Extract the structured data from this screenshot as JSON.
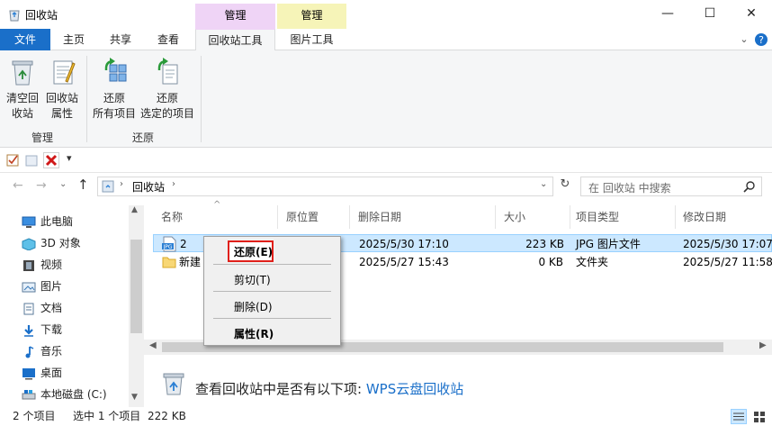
{
  "window": {
    "title": "回收站",
    "context_header_1": "管理",
    "context_header_2": "管理",
    "minimize_glyph": "—",
    "maximize_glyph": "☐",
    "close_glyph": "✕"
  },
  "tabs": {
    "file": "文件",
    "home": "主页",
    "share": "共享",
    "view": "查看",
    "recycle_tools": "回收站工具",
    "picture_tools": "图片工具"
  },
  "ribbon": {
    "empty_line1": "清空回",
    "empty_line2": "收站",
    "props_line1": "回收站",
    "props_line2": "属性",
    "restore_all_line1": "还原",
    "restore_all_line2": "所有项目",
    "restore_sel_line1": "还原",
    "restore_sel_line2": "选定的项目",
    "group_manage": "管理",
    "group_restore": "还原"
  },
  "address": {
    "path": "回收站",
    "search_placeholder": "在 回收站 中搜索"
  },
  "nav": {
    "items": [
      "此电脑",
      "3D 对象",
      "视频",
      "图片",
      "文档",
      "下载",
      "音乐",
      "桌面",
      "本地磁盘 (C:)"
    ]
  },
  "columns": {
    "name": "名称",
    "orig": "原位置",
    "deleted": "删除日期",
    "size": "大小",
    "type": "项目类型",
    "modified": "修改日期"
  },
  "files": [
    {
      "name": "2",
      "deleted": "2025/5/30 17:10",
      "size": "223 KB",
      "type": "JPG 图片文件",
      "modified": "2025/5/30 17:07",
      "icon_label": "JPG"
    },
    {
      "name": "新建",
      "deleted": "2025/5/27 15:43",
      "size": "0 KB",
      "type": "文件夹",
      "modified": "2025/5/27 11:58"
    }
  ],
  "context_menu": {
    "restore": "还原(E)",
    "cut": "剪切(T)",
    "delete": "删除(D)",
    "properties": "属性(R)"
  },
  "banner": {
    "text": "查看回收站中是否有以下项: ",
    "link": "WPS云盘回收站"
  },
  "status": {
    "count": "2 个项目",
    "selected": "选中 1 个项目",
    "size": "222 KB"
  },
  "colors": {
    "accent": "#1a6fc9",
    "context_tab_1": "#efd4f6",
    "context_tab_2": "#f6f4b8",
    "selection": "#cce8ff",
    "highlight_box": "#e0201a"
  }
}
